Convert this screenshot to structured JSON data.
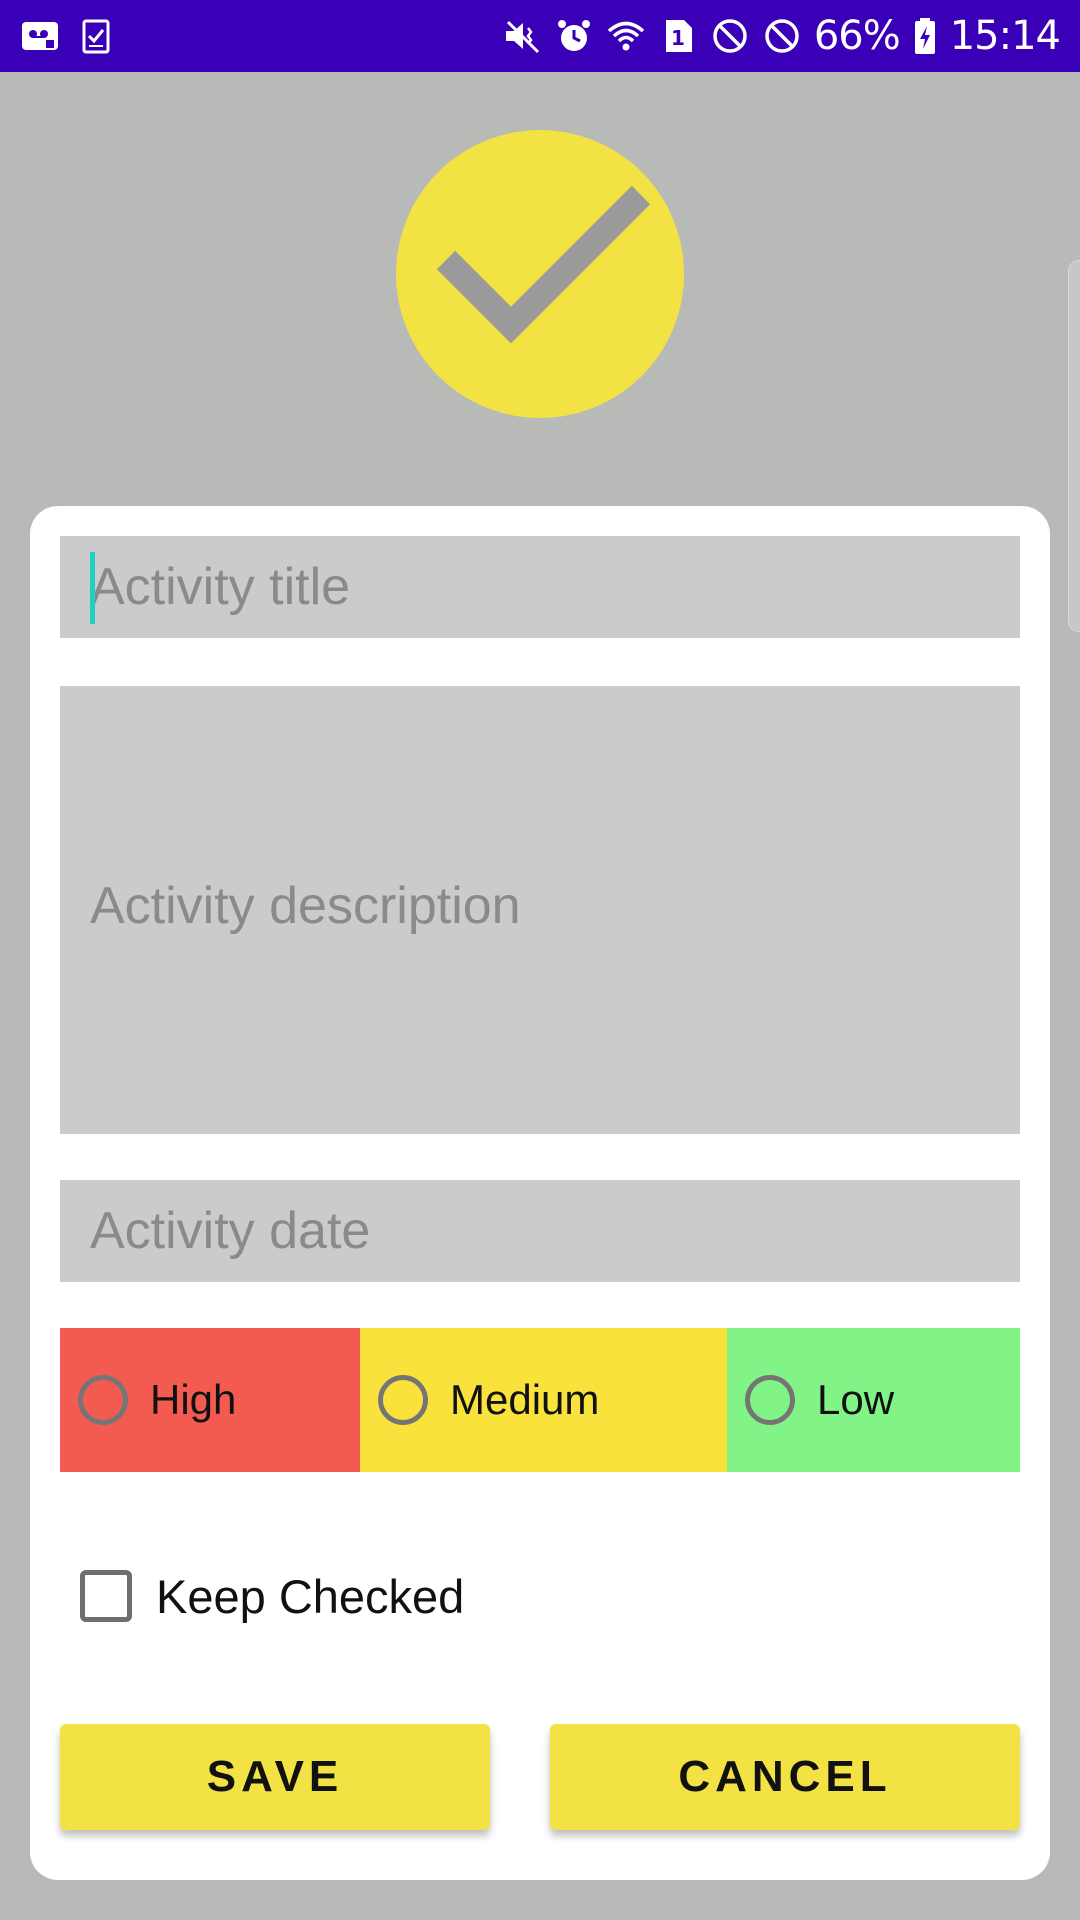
{
  "status_bar": {
    "battery_percent": "66%",
    "time": "15:14",
    "sim_badge": "1",
    "background_color": "#3a00b7",
    "left_icons": [
      "voicemail-icon",
      "task-check-icon"
    ],
    "right_icons": [
      "vibrate-mute-icon",
      "alarm-icon",
      "wifi-icon",
      "sim-icon",
      "block-icon",
      "block-icon",
      "battery-charging-icon"
    ]
  },
  "header": {
    "icon": "checkmark-icon",
    "accent_color": "#f2e244"
  },
  "form": {
    "title_placeholder": "Activity title",
    "description_placeholder": "Activity description",
    "date_placeholder": "Activity date",
    "priority_options": [
      {
        "label": "High",
        "color": "#f45b50"
      },
      {
        "label": "Medium",
        "color": "#f9e23c"
      },
      {
        "label": "Low",
        "color": "#82f386"
      }
    ],
    "keep_checked_label": "Keep Checked",
    "keep_checked_value": false
  },
  "buttons": {
    "save_label": "SAVE",
    "cancel_label": "CANCEL",
    "color": "#f2e244"
  }
}
